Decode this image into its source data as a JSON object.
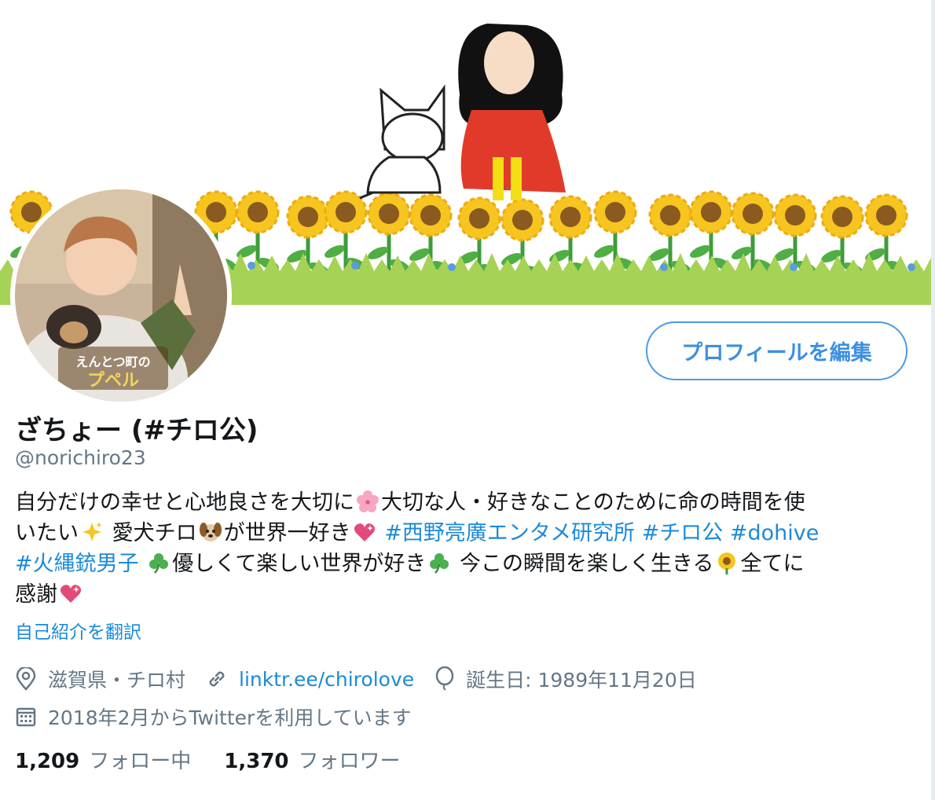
{
  "profile": {
    "display_name": "ざちょー (#チロ公)",
    "handle": "@norichiro23",
    "edit_button_label": "プロフィールを編集",
    "bio": {
      "line1_text": "自分だけの幸せと心地良さを大切に",
      "line1_after_emoji": "大切な人・好きなことのために命の時間を使",
      "line2_text": "いたい",
      "line2_after_sparkles": " 愛犬チロ",
      "line2_after_dog": "が世界一好き",
      "hashtag_1": "#西野亮廣エンタメ研究所",
      "hashtag_2": "#チロ公",
      "hashtag_3": "#dohive",
      "hashtag_4": "#火縄銃男子",
      "line3_after_clover": "優しくて楽しい世界が好き",
      "line3_after_clover2": " 今この瞬間を楽しく生きる",
      "line3_after_sunflower": "全てに",
      "line4_text": "感謝"
    },
    "translate_label": "自己紹介を翻訳",
    "location": "滋賀県・チロ村",
    "website": "linktr.ee/chirolove",
    "birthday": "誕生日: 1989年11月20日",
    "joined": "2018年2月からTwitterを利用しています",
    "following_count": "1,209",
    "following_label": "フォロー中",
    "followers_count": "1,370",
    "followers_label": "フォロワー",
    "avatar_caption": "えんとつ町のプペル"
  },
  "icons": [
    "location-icon",
    "link-icon",
    "birthday-balloon-icon",
    "calendar-icon"
  ],
  "colors": {
    "accent": "#1b8ad8",
    "button_border": "#4a9ae8",
    "secondary_text": "#657786"
  }
}
